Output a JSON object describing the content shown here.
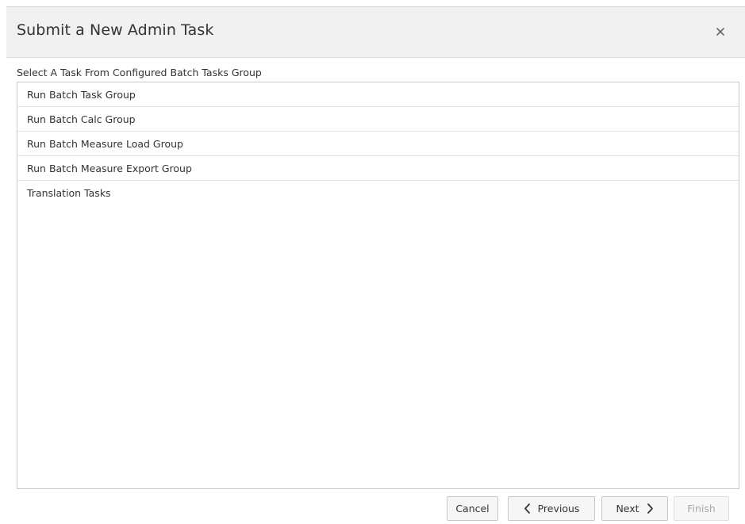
{
  "dialog": {
    "title": "Submit a New Admin Task",
    "close_icon": "close-icon"
  },
  "instruction": "Select A Task From Configured Batch Tasks Group",
  "tasks": [
    {
      "label": "Run Batch Task Group"
    },
    {
      "label": "Run Batch Calc Group"
    },
    {
      "label": "Run Batch Measure Load Group"
    },
    {
      "label": "Run Batch Measure Export Group"
    },
    {
      "label": "Translation Tasks"
    }
  ],
  "footer": {
    "cancel_label": "Cancel",
    "previous_label": "Previous",
    "next_label": "Next",
    "finish_label": "Finish",
    "finish_disabled": true
  },
  "colors": {
    "header_bg": "#f1f1f1",
    "border": "#c9c9c9",
    "disabled_text": "#a8a8a8"
  }
}
